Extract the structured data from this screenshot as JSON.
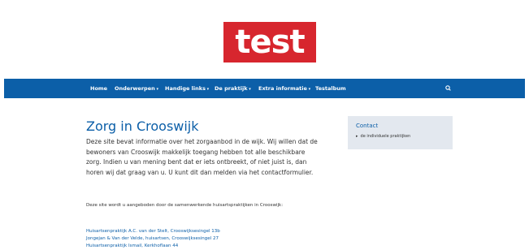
{
  "brand": {
    "logo_text": "test",
    "logo_color": "#d7262e"
  },
  "colors": {
    "nav_bg": "#0c5fa8",
    "link": "#0c5fa8",
    "sidebar_bg": "#e3e8ef"
  },
  "nav": {
    "items": [
      "Home",
      "Onderwerpen",
      "Handige links",
      "De praktijk",
      "Extra informatie",
      "Testalbum"
    ]
  },
  "main": {
    "title": "Zorg in Crooswijk",
    "intro": "Deze site bevat informatie over het zorgaanbod in de wijk. Wij willen dat de bewoners van Crooswijk makkelijk toegang hebben tot alle beschikbare zorg. Indien u van mening bent dat er iets ontbreekt, of niet juist is, dan horen wij dat graag van u. U kunt dit dan melden via het contactformulier.",
    "note": "Deze site wordt u aangeboden door de samenwerkende huisartspraktijken in Crooswijk:",
    "practices": [
      "Huisartsenpraktijk A.C. van der Stelt, Crooswijksesingel 13b",
      "Jongejan & Van der Velde, huisartsen, Crooswijksesingel 27",
      "Huisartsenpraktijk Ismail, Kerkhoflaan 44"
    ]
  },
  "sidebar": {
    "contact_title": "Contact",
    "contact_link": "de individuele praktijken"
  }
}
